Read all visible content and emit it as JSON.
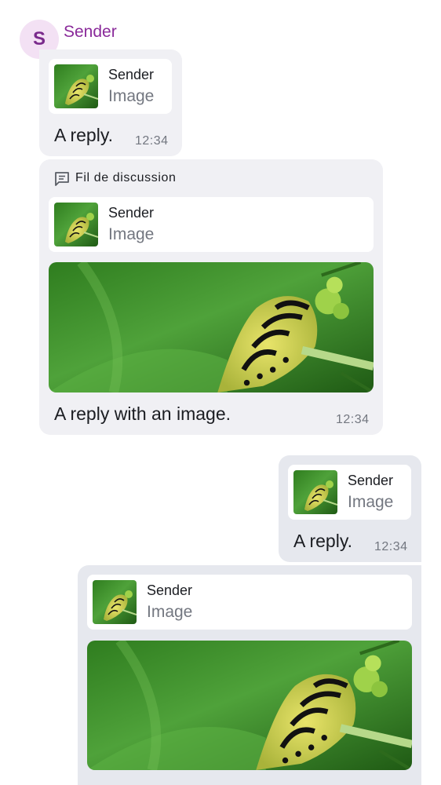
{
  "sender": {
    "avatar_letter": "S",
    "name": "Sender",
    "avatar_bg": "#f3e1f4",
    "name_color": "#8a2a9a"
  },
  "messages": [
    {
      "direction": "incoming",
      "reply_to": {
        "sender": "Sender",
        "type": "Image",
        "thumbnail_icon": "caterpillar-thumbnail"
      },
      "text": "A reply.",
      "time": "12:34"
    },
    {
      "direction": "incoming",
      "thread_label": "Fil de discussion",
      "thread_icon": "thread-icon",
      "reply_to": {
        "sender": "Sender",
        "type": "Image",
        "thumbnail_icon": "caterpillar-thumbnail"
      },
      "image": "caterpillar-photo",
      "text": "A reply with an image.",
      "time": "12:34"
    },
    {
      "direction": "outgoing",
      "reply_to": {
        "sender": "Sender",
        "type": "Image",
        "thumbnail_icon": "caterpillar-thumbnail"
      },
      "text": "A reply.",
      "time": "12:34"
    },
    {
      "direction": "outgoing",
      "reply_to": {
        "sender": "Sender",
        "type": "Image",
        "thumbnail_icon": "caterpillar-thumbnail"
      },
      "image": "caterpillar-photo"
    }
  ],
  "colors": {
    "incoming_bubble": "#f0f0f4",
    "outgoing_bubble": "#e6e8ee",
    "text_primary": "#1b1d22",
    "text_secondary": "#737780"
  }
}
